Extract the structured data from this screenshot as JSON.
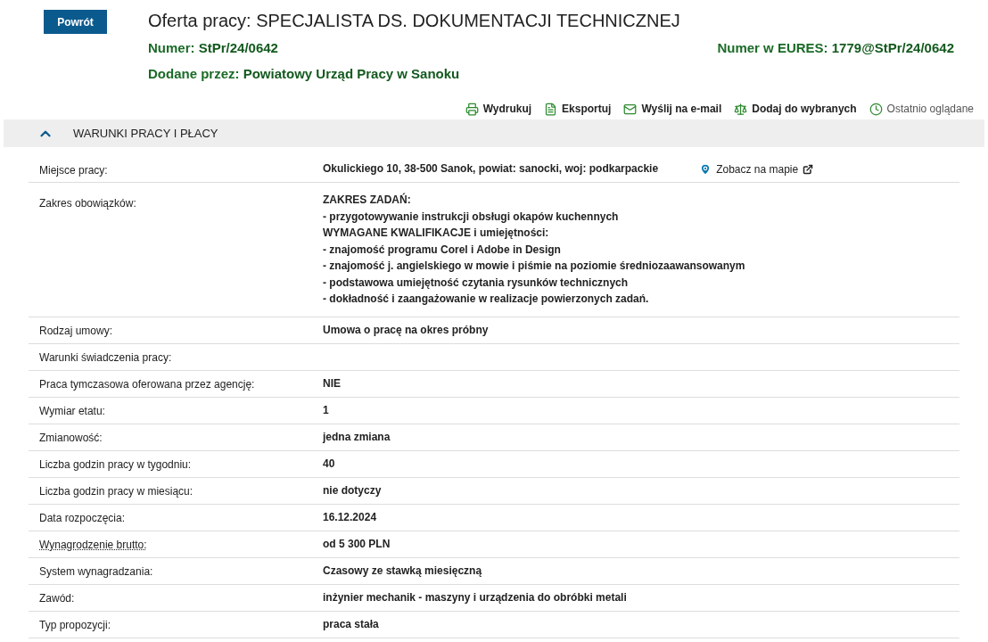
{
  "back_button": "Powrót",
  "title": "Oferta pracy: SPECJALISTA DS. DOKUMENTACJI TECHNICZNEJ",
  "meta": [
    {
      "label": "Numer:",
      "value": "StPr/24/0642"
    },
    {
      "label": "Numer w EURES:",
      "value": "1779@StPr/24/0642"
    },
    {
      "label": "Dodane przez:",
      "value": "Powiatowy Urząd Pracy w Sanoku"
    }
  ],
  "actions": [
    {
      "kind": "print",
      "label": "Wydrukuj",
      "muted": false
    },
    {
      "kind": "pdf",
      "label": "Eksportuj",
      "muted": false
    },
    {
      "kind": "mail",
      "label": "Wyślij na e-mail",
      "muted": false
    },
    {
      "kind": "favorite",
      "label": "Dodaj do wybranych",
      "muted": false
    },
    {
      "kind": "history",
      "label": "Ostatnio oglądane",
      "muted": true
    }
  ],
  "section": {
    "title": "WARUNKI PRACY I PŁACY",
    "expanded": true
  },
  "rows": [
    {
      "label": "Miejsce pracy:",
      "tooltip": false,
      "lines": [
        "Okulickiego 10, 38-500 Sanok, powiat: sanocki, woj: podkarpackie"
      ],
      "map_link": "Zobacz na mapie"
    },
    {
      "label": "Zakres obowiązków:",
      "tooltip": false,
      "lines": [
        "ZAKRES ZADAŃ:",
        "- przygotowywanie instrukcji obsługi okapów kuchennych",
        "WYMAGANE KWALIFIKACJE i umiejętności:",
        "- znajomość programu Corel i Adobe in Design",
        "- znajomość j. angielskiego w mowie i piśmie na poziomie średniozaawansowanym",
        "- podstawowa umiejętność czytania rysunków technicznych",
        "- dokładność i zaangażowanie w realizacje powierzonych zadań."
      ]
    },
    {
      "label": "Rodzaj umowy:",
      "tooltip": false,
      "lines": [
        "Umowa o pracę na okres próbny"
      ]
    },
    {
      "label": "Warunki świadczenia pracy:",
      "tooltip": false,
      "lines": []
    },
    {
      "label": "Praca tymczasowa oferowana przez agencję:",
      "tooltip": false,
      "lines": [
        "NIE"
      ]
    },
    {
      "label": "Wymiar etatu:",
      "tooltip": false,
      "lines": [
        "1"
      ]
    },
    {
      "label": "Zmianowość:",
      "tooltip": false,
      "lines": [
        "jedna zmiana"
      ]
    },
    {
      "label": "Liczba godzin pracy w tygodniu:",
      "tooltip": false,
      "lines": [
        "40"
      ]
    },
    {
      "label": "Liczba godzin pracy w miesiącu:",
      "tooltip": false,
      "lines": [
        "nie dotyczy"
      ]
    },
    {
      "label": "Data rozpoczęcia:",
      "tooltip": false,
      "lines": [
        "16.12.2024"
      ]
    },
    {
      "label": "Wynagrodzenie brutto:",
      "tooltip": true,
      "lines": [
        "od 5 300 PLN"
      ]
    },
    {
      "label": "System wynagradzania:",
      "tooltip": false,
      "lines": [
        "Czasowy ze stawką miesięczną"
      ]
    },
    {
      "label": "Zawód:",
      "tooltip": false,
      "lines": [
        "inżynier mechanik - maszyny i urządzenia do obróbki metali"
      ]
    },
    {
      "label": "Typ propozycji:",
      "tooltip": false,
      "lines": [
        "praca stała"
      ]
    }
  ]
}
